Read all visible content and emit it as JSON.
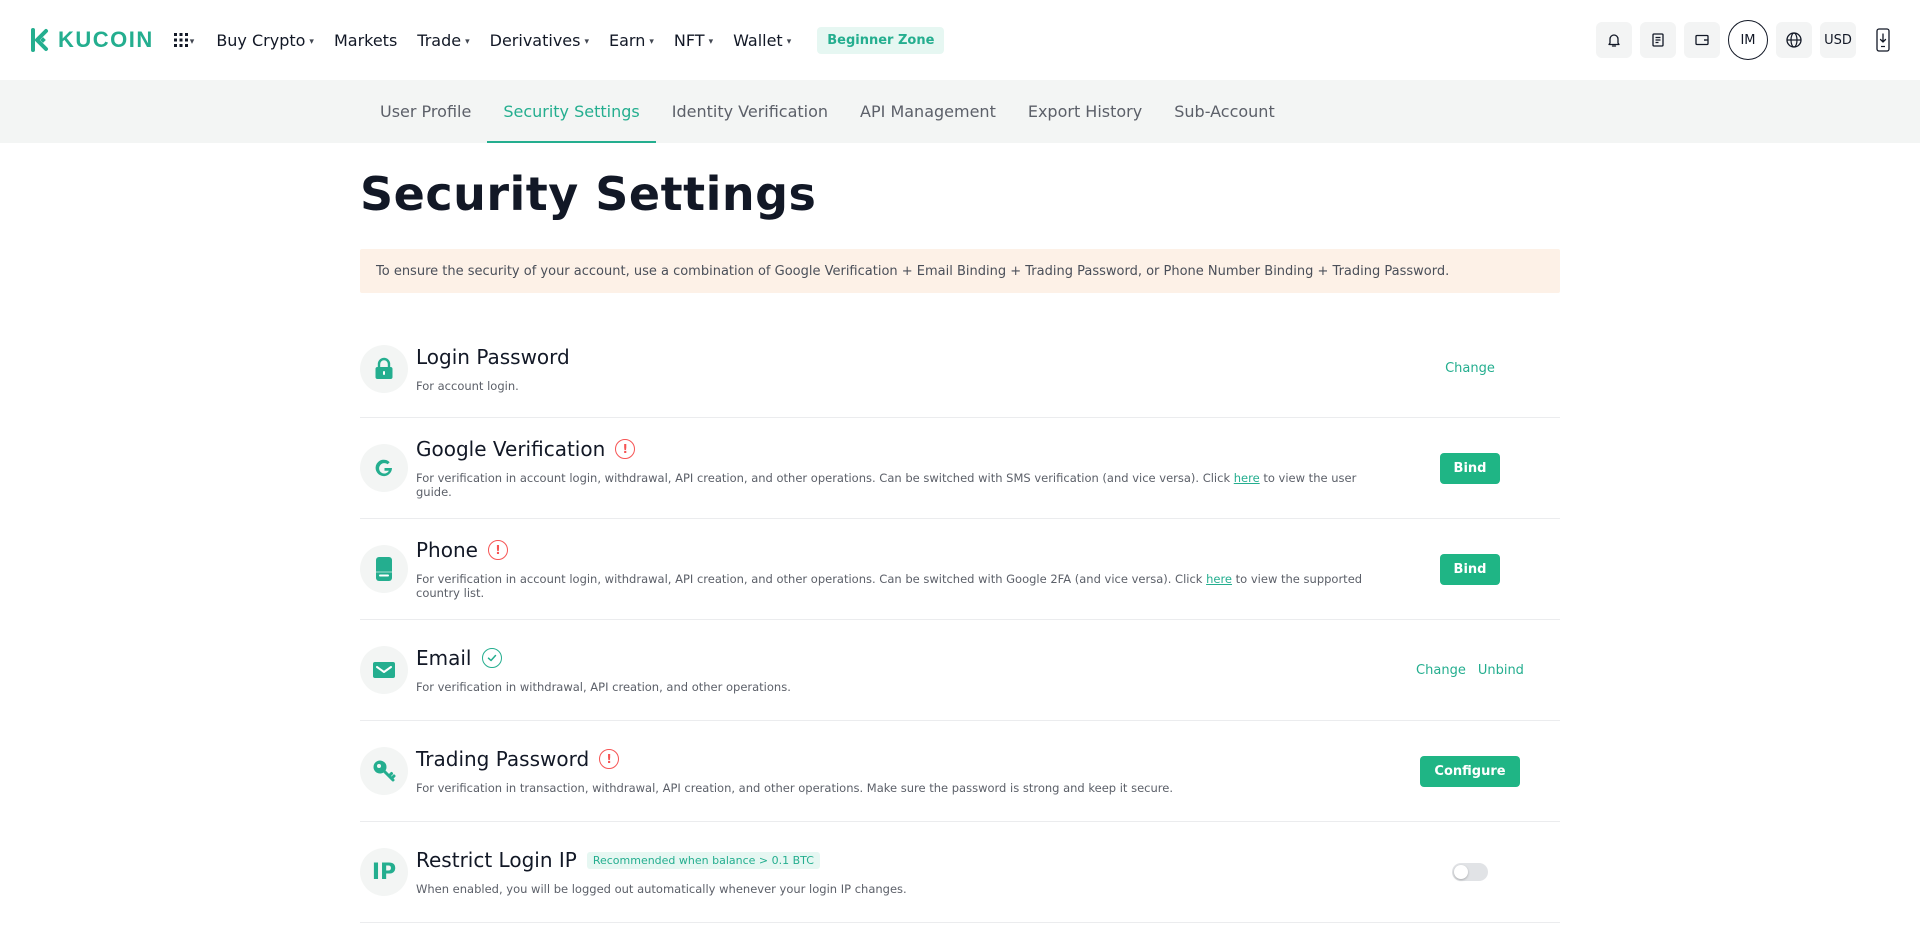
{
  "brand": {
    "name": "KUCOIN",
    "accent": "#24ae8f"
  },
  "nav": {
    "items": [
      {
        "label": "Buy Crypto",
        "dropdown": true
      },
      {
        "label": "Markets",
        "dropdown": false
      },
      {
        "label": "Trade",
        "dropdown": true
      },
      {
        "label": "Derivatives",
        "dropdown": true
      },
      {
        "label": "Earn",
        "dropdown": true
      },
      {
        "label": "NFT",
        "dropdown": true
      },
      {
        "label": "Wallet",
        "dropdown": true
      }
    ],
    "beginner_zone": "Beginner Zone",
    "avatar_initials": "IM",
    "currency": "USD"
  },
  "subnav": {
    "tabs": [
      {
        "label": "User Profile",
        "active": false
      },
      {
        "label": "Security Settings",
        "active": true
      },
      {
        "label": "Identity Verification",
        "active": false
      },
      {
        "label": "API Management",
        "active": false
      },
      {
        "label": "Export History",
        "active": false
      },
      {
        "label": "Sub-Account",
        "active": false
      }
    ]
  },
  "page": {
    "title": "Security Settings",
    "notice": "To ensure the security of your account, use a combination of Google Verification + Email Binding + Trading Password, or Phone Number Binding + Trading Password."
  },
  "settings": {
    "login_password": {
      "title": "Login Password",
      "desc": "For account login.",
      "action": "Change",
      "icon": "lock-icon"
    },
    "google": {
      "title": "Google Verification",
      "desc_before": "For verification in account login, withdrawal, API creation, and other operations. Can be switched with SMS verification (and vice versa). Click ",
      "link": "here",
      "desc_after": " to view the user guide.",
      "action": "Bind",
      "status": "warning",
      "icon": "google-icon"
    },
    "phone": {
      "title": "Phone",
      "desc_before": "For verification in account login, withdrawal, API creation, and other operations. Can be switched with Google 2FA (and vice versa). Click ",
      "link": "here",
      "desc_after": " to view the supported country list.",
      "action": "Bind",
      "status": "warning",
      "icon": "phone-icon"
    },
    "email": {
      "title": "Email",
      "desc": "For verification in withdrawal, API creation, and other operations.",
      "action_change": "Change",
      "action_unbind": "Unbind",
      "status": "verified",
      "icon": "mail-icon"
    },
    "trading_password": {
      "title": "Trading Password",
      "desc": "For verification in transaction, withdrawal, API creation, and other operations. Make sure the password is strong and keep it secure.",
      "action": "Configure",
      "status": "warning",
      "icon": "key-icon"
    },
    "restrict_ip": {
      "title": "Restrict Login IP",
      "tag": "Recommended when balance > 0.1 BTC",
      "desc": "When enabled, you will be logged out automatically whenever your login IP changes.",
      "icon_text": "IP",
      "enabled": false
    }
  },
  "colors": {
    "accent": "#24ae8f",
    "button": "#1fb585",
    "warning": "#f65454",
    "notice_bg": "#fdf1e7",
    "subnav_bg": "#f3f5f4"
  }
}
